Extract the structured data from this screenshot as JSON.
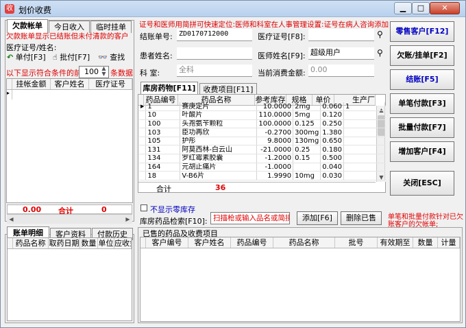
{
  "window": {
    "title": "划价收费",
    "icon": "收"
  },
  "left": {
    "tabs": [
      "欠款帐单",
      "今日收入",
      "临时挂单"
    ],
    "notice": "欠款账单显示已结账但未付清款的客户",
    "cert_label": "医疗证号/姓名:",
    "single_pay": "单付[F3]",
    "batch_pay": "批付[F7]",
    "search": "查找",
    "days_prefix": "以下显示符合条件的前",
    "days_value": "100",
    "days_suffix": "条数据",
    "columns": [
      "挂帐金额",
      "客户姓名",
      "医疗证号"
    ],
    "total_left": "0.00",
    "total_label": "合计",
    "total_right": "0"
  },
  "detail": {
    "tabs": [
      "账单明细",
      "客户资料",
      "付款历史"
    ],
    "columns": [
      "药品名称",
      "取药日期",
      "数量",
      "单位",
      "应收金"
    ]
  },
  "header": {
    "notice": "证号和医师用简拼可快速定位:医师和科室在人事管理设置:证号在病人咨询添加",
    "bill_label": "结账单号:",
    "bill_value": "ZD0170712000",
    "cert_label": "医疗证号[F8]:",
    "patient_label": "患者姓名:",
    "doctor_label": "医师姓名[F9]:",
    "doctor_value": "超级用户",
    "dept_label": "科    室:",
    "dept_value": "全科",
    "amount_label": "当前消费金额:",
    "amount_value": "0.00"
  },
  "inventory": {
    "tabs": [
      "库房药物[F11]",
      "收费项目[F11]"
    ],
    "columns": [
      "药品编号",
      "药品名称",
      "参考库存",
      "规格",
      "单价",
      "生产厂"
    ],
    "rows": [
      {
        "code": "1",
        "name": "赛庚定片",
        "stock": "10.0000",
        "spec": "2mg",
        "price": "0.060",
        "maker": "1"
      },
      {
        "code": "10",
        "name": "叶酸片",
        "stock": "110.0000",
        "spec": "5mg",
        "price": "0.120",
        "maker": ""
      },
      {
        "code": "100",
        "name": "头孢氨苄颗粒",
        "stock": "100.0000",
        "spec": "0.125",
        "price": "0.250",
        "maker": ""
      },
      {
        "code": "103",
        "name": "臣功再欣",
        "stock": "-0.2700",
        "spec": "300mg",
        "price": "1.380",
        "maker": ""
      },
      {
        "code": "105",
        "name": "护彤",
        "stock": "9.8000",
        "spec": "130mg",
        "price": "0.650",
        "maker": ""
      },
      {
        "code": "131",
        "name": "阿莫西林-白云山",
        "stock": "-21.0000",
        "spec": "0.25",
        "price": "0.180",
        "maker": ""
      },
      {
        "code": "134",
        "name": "罗红霉素胶囊",
        "stock": "-1.2000",
        "spec": "0.15",
        "price": "0.500",
        "maker": ""
      },
      {
        "code": "164",
        "name": "元胡止痛片",
        "stock": "-1.0000",
        "spec": "",
        "price": "0.040",
        "maker": ""
      },
      {
        "code": "18",
        "name": "V-B6片",
        "stock": "1.9990",
        "spec": "10mg",
        "price": "0.030",
        "maker": ""
      }
    ],
    "total_label": "合计",
    "total_value": "36"
  },
  "filter": {
    "zero_stock": "不显示零库存",
    "search_label": "库房药品检索[F10]:",
    "search_placeholder": "扫描枪或输入品名或简拼",
    "add": "添加[F6]",
    "delete": "删除已售",
    "hint": "单笔和批量付款针对已欠账客户的欠帐单;"
  },
  "sold": {
    "title": "已售的药品及收费项目",
    "columns": [
      "客户编号",
      "客户姓名",
      "药品编号",
      "药品名称",
      "批号",
      "有效期至",
      "数量",
      "计量"
    ]
  },
  "actions": [
    "零售客户[F12]",
    "欠账/挂单[F2]",
    "结账[F5]",
    "单笔付款[F3]",
    "批量付款[F7]",
    "增加客户[F4]",
    "关闭[ESC]"
  ],
  "colors": {
    "notice": "#e00000",
    "accent_blue": "#0000c0",
    "total_red": "#e00000"
  }
}
